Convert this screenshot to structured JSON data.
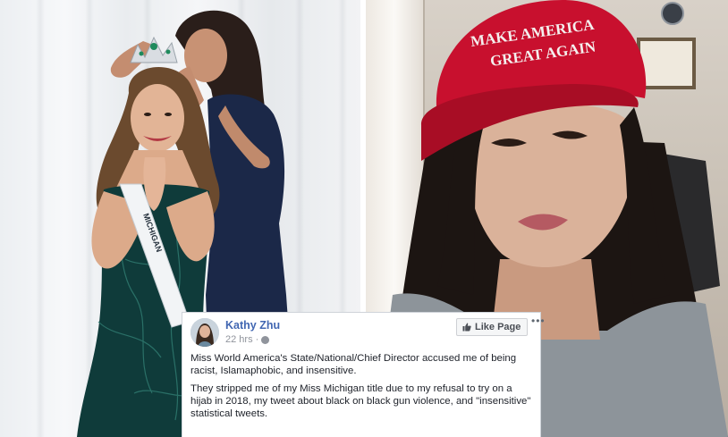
{
  "photos": {
    "left": {
      "sash_text": "MICHIGAN"
    },
    "right": {
      "cap_line1": "MAKE AMERICA",
      "cap_line2": "GREAT AGAIN"
    }
  },
  "post": {
    "author": "Kathy Zhu",
    "time": "22 hrs ·",
    "like_button": "Like Page",
    "more": "•••",
    "paragraph1": "Miss World America's State/National/Chief Director accused me of being racist, Islamaphobic, and insensitive.",
    "paragraph2": "They stripped me of my Miss Michigan title due to my refusal to try on a hijab in 2018, my tweet about black on black gun violence, and \"insensitive\" statistical tweets."
  },
  "colors": {
    "facebook_blue": "#4267b2",
    "maga_red": "#c8102e",
    "gown_teal": "#0f3b3a",
    "dress_navy": "#1b2848"
  }
}
